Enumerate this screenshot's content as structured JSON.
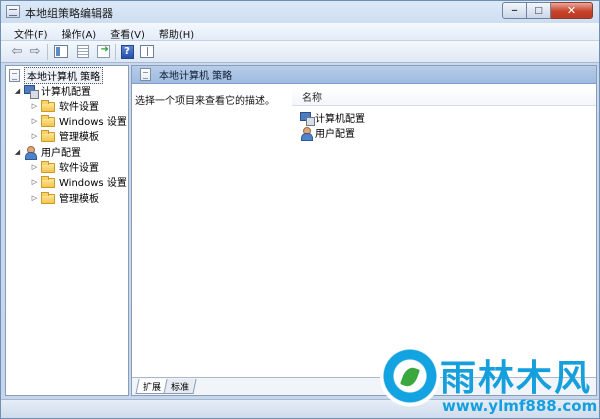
{
  "window": {
    "title": "本地组策略编辑器"
  },
  "caption": {
    "minimize": "‒",
    "maximize": "□",
    "close": "✕"
  },
  "menu": [
    "文件(F)",
    "操作(A)",
    "查看(V)",
    "帮助(H)"
  ],
  "toolbar": {
    "back": "⇦",
    "forward": "⇨",
    "help": "?"
  },
  "tree": {
    "root": "本地计算机 策略",
    "computer": {
      "label": "计算机配置",
      "children": [
        "软件设置",
        "Windows 设置",
        "管理模板"
      ]
    },
    "user": {
      "label": "用户配置",
      "children": [
        "软件设置",
        "Windows 设置",
        "管理模板"
      ]
    }
  },
  "main": {
    "header_title": "本地计算机 策略",
    "description": "选择一个项目来查看它的描述。",
    "column_header": "名称",
    "items": [
      "计算机配置",
      "用户配置"
    ]
  },
  "tabs": [
    "扩展",
    "标准"
  ],
  "watermark": {
    "brand": "雨林木风",
    "url": "www.ylmf888.com"
  },
  "colors": {
    "accent": "#15a0dd",
    "header": "#a9c3e5"
  }
}
